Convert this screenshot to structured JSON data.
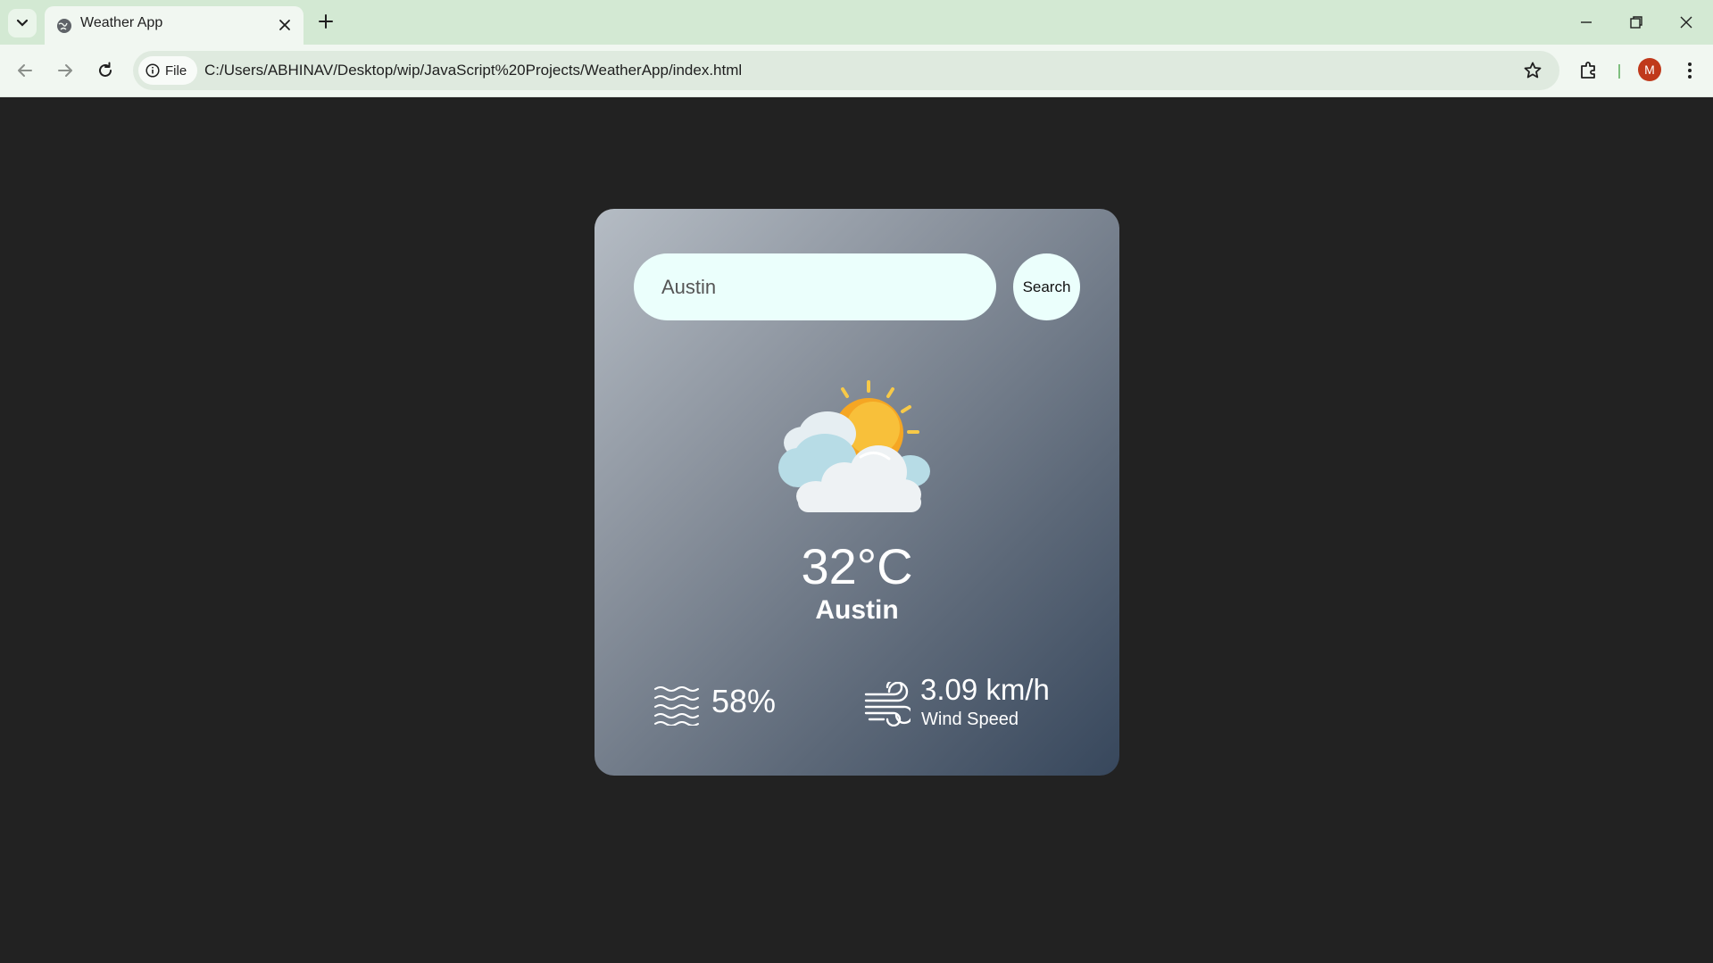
{
  "browser": {
    "tab_title": "Weather App",
    "file_chip_label": "File",
    "url": "C:/Users/ABHINAV/Desktop/wip/JavaScript%20Projects/WeatherApp/index.html",
    "profile_initial": "M"
  },
  "weather": {
    "search_value": "Austin",
    "search_button_label": "Search",
    "icon": "partly-cloudy-icon",
    "temperature": "32°C",
    "city": "Austin",
    "humidity": "58%",
    "wind_speed": "3.09 km/h",
    "wind_label": "Wind Speed"
  },
  "colors": {
    "background": "#222222",
    "input_background": "#ebfffc",
    "chrome_background": "#d3e9d3"
  }
}
